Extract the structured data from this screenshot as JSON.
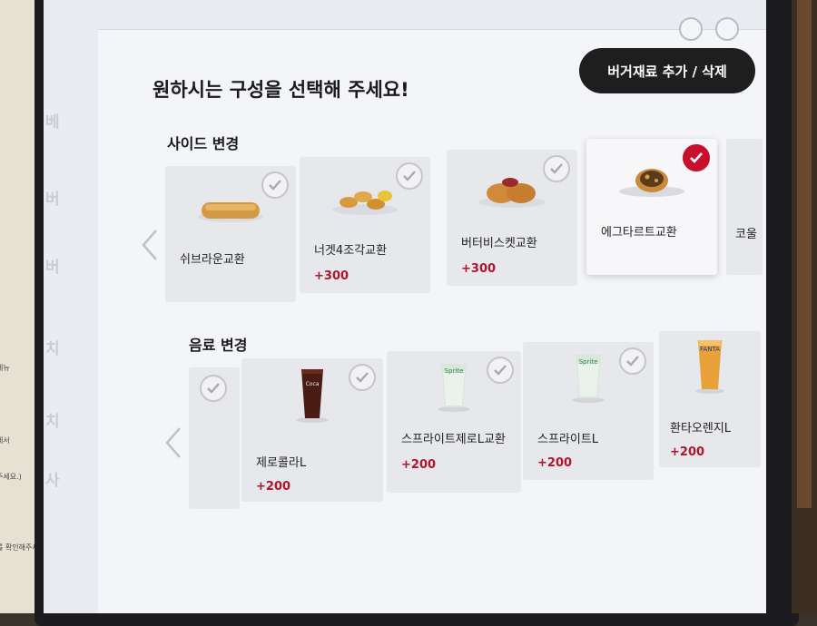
{
  "page": {
    "title": "원하시는 구성을 선택해 주세요!",
    "edit_button": "버거재료 추가 / 삭제"
  },
  "side": {
    "label": "사이드 변경",
    "items": [
      {
        "name": "쉬브라운교환",
        "price": "",
        "selected": false,
        "icon": "hash-brown-icon"
      },
      {
        "name": "너겟4조각교환",
        "price": "+300",
        "selected": false,
        "icon": "nuggets-icon"
      },
      {
        "name": "버터비스켓교환",
        "price": "+300",
        "selected": false,
        "icon": "biscuit-icon"
      },
      {
        "name": "에그타르트교환",
        "price": "",
        "selected": true,
        "icon": "egg-tart-icon"
      },
      {
        "name": "코울",
        "price": "",
        "selected": false,
        "icon": ""
      }
    ]
  },
  "drink": {
    "label": "음료 변경",
    "items": [
      {
        "name": "",
        "price": "",
        "selected": false,
        "icon": ""
      },
      {
        "name": "제로콜라L",
        "price": "+200",
        "selected": false,
        "icon": "cola-cup-icon"
      },
      {
        "name": "스프라이트제로L교환",
        "price": "+200",
        "selected": false,
        "icon": "sprite-zero-cup-icon"
      },
      {
        "name": "스프라이트L",
        "price": "+200",
        "selected": false,
        "icon": "sprite-cup-icon"
      },
      {
        "name": "환타오렌지L",
        "price": "+200",
        "selected": false,
        "icon": "fanta-cup-icon"
      }
    ]
  },
  "colors": {
    "accent": "#c8102e",
    "price": "#b1152a",
    "button_bg": "#1e1e1e"
  },
  "paper_notes": [
    "제뉴",
    "에서",
    "주세요.)",
    "를 확인해주세요.)"
  ]
}
